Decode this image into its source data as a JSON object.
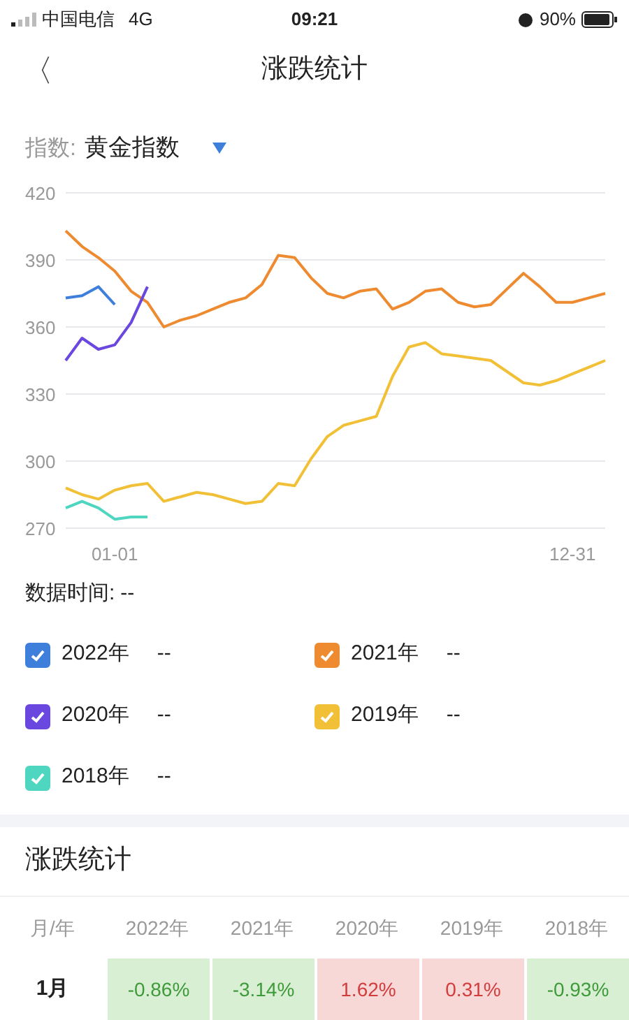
{
  "status_bar": {
    "carrier": "中国电信",
    "network": "4G",
    "time": "09:21",
    "battery": "90%"
  },
  "nav": {
    "back": "〈",
    "title": "涨跌统计"
  },
  "selector": {
    "label": "指数:",
    "value": "黄金指数"
  },
  "chart_data": {
    "type": "line",
    "categories": [
      null,
      null,
      null,
      "01-01",
      null,
      null,
      null,
      null,
      null,
      null,
      null,
      null,
      null,
      null,
      null,
      null,
      null,
      null,
      null,
      null,
      null,
      null,
      null,
      null,
      null,
      null,
      null,
      null,
      null,
      null,
      null,
      "12-31",
      null,
      null
    ],
    "grid": true,
    "ylim": [
      270,
      420
    ],
    "yticks": [
      270,
      300,
      330,
      360,
      390,
      420
    ],
    "series": [
      {
        "name": "2022年",
        "color": "#3f7fdc",
        "values": [
          373,
          374,
          378,
          370,
          null,
          null,
          null,
          null,
          null,
          null,
          null,
          null,
          null,
          null,
          null,
          null,
          null,
          null,
          null,
          null,
          null,
          null,
          null,
          null,
          null,
          null,
          null,
          null,
          null,
          null,
          null,
          null,
          null,
          null
        ]
      },
      {
        "name": "2021年",
        "color": "#ee8a2f",
        "values": [
          403,
          396,
          391,
          385,
          376,
          371,
          360,
          363,
          365,
          368,
          371,
          373,
          379,
          392,
          391,
          382,
          375,
          373,
          376,
          377,
          368,
          371,
          376,
          377,
          371,
          369,
          370,
          377,
          384,
          378,
          371,
          371,
          373,
          375
        ]
      },
      {
        "name": "2020年",
        "color": "#6a48e0",
        "values": [
          345,
          355,
          350,
          352,
          362,
          378,
          null,
          null,
          null,
          null,
          null,
          null,
          null,
          null,
          null,
          null,
          null,
          null,
          null,
          null,
          null,
          null,
          null,
          null,
          null,
          null,
          null,
          null,
          null,
          null,
          null,
          null,
          null,
          null
        ]
      },
      {
        "name": "2019年",
        "color": "#f2c037",
        "values": [
          288,
          285,
          283,
          287,
          289,
          290,
          282,
          284,
          286,
          285,
          283,
          281,
          282,
          290,
          289,
          301,
          311,
          316,
          318,
          320,
          338,
          351,
          353,
          348,
          347,
          346,
          345,
          340,
          335,
          334,
          336,
          339,
          342,
          345
        ]
      },
      {
        "name": "2018年",
        "color": "#4ed6c0",
        "values": [
          279,
          282,
          279,
          274,
          275,
          275,
          null,
          null,
          null,
          null,
          null,
          null,
          null,
          null,
          null,
          null,
          null,
          null,
          null,
          null,
          null,
          null,
          null,
          null,
          null,
          null,
          null,
          null,
          null,
          null,
          null,
          null,
          null,
          null
        ]
      }
    ]
  },
  "data_time": {
    "label": "数据时间:",
    "value": "--"
  },
  "legend": [
    {
      "value": "--",
      "checked": true
    },
    {
      "value": "--",
      "checked": true
    },
    {
      "value": "--",
      "checked": true
    },
    {
      "value": "--",
      "checked": true
    },
    {
      "value": "--",
      "checked": true
    }
  ],
  "stats": {
    "title": "涨跌统计",
    "columns": [
      "月/年",
      "2022年",
      "2021年",
      "2020年",
      "2019年",
      "2018年"
    ],
    "rows": [
      {
        "cells": [
          {
            "text": "1月",
            "kind": "month"
          },
          {
            "text": "-0.86%",
            "kind": "down"
          },
          {
            "text": "-3.14%",
            "kind": "down"
          },
          {
            "text": "1.62%",
            "kind": "up"
          },
          {
            "text": "0.31%",
            "kind": "up"
          },
          {
            "text": "-0.93%",
            "kind": "down"
          }
        ]
      }
    ]
  }
}
